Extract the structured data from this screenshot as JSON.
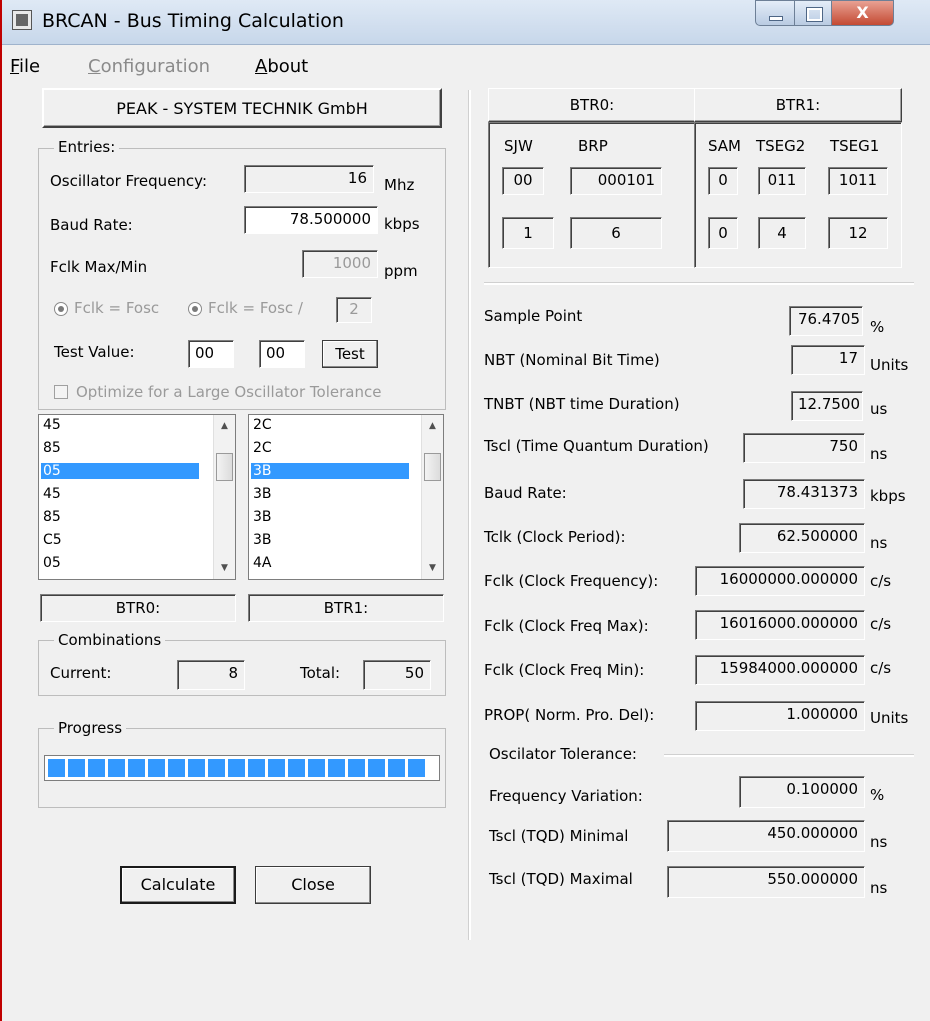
{
  "window": {
    "title": "BRCAN - Bus Timing Calculation",
    "close_glyph": "X"
  },
  "menu": {
    "file": "File",
    "configuration": "Configuration",
    "about": "About"
  },
  "company": "PEAK - SYSTEM TECHNIK GmbH",
  "entries": {
    "legend": "Entries:",
    "osc_label": "Oscillator Frequency:",
    "osc_value": "16",
    "osc_unit": "Mhz",
    "baud_label": "Baud Rate:",
    "baud_value": "78.500000",
    "baud_unit": "kbps",
    "fclk_label": "Fclk Max/Min",
    "fclk_value": "1000",
    "fclk_unit": "ppm",
    "radio1": "Fclk = Fosc",
    "radio2": "Fclk = Fosc /",
    "divider": "2",
    "test_label": "Test Value:",
    "test1": "00",
    "test2": "00",
    "test_button": "Test",
    "optimize": "Optimize for a Large Oscillator Tolerance"
  },
  "list_left": [
    "45",
    "85",
    "05",
    "45",
    "85",
    "C5",
    "05"
  ],
  "list_left_selected": 2,
  "list_right": [
    "2C",
    "2C",
    "3B",
    "3B",
    "3B",
    "3B",
    "4A"
  ],
  "list_right_selected": 2,
  "btr0_label": "BTR0:",
  "btr1_label": "BTR1:",
  "combinations": {
    "legend": "Combinations",
    "current_label": "Current:",
    "current_value": "8",
    "total_label": "Total:",
    "total_value": "50"
  },
  "progress": {
    "legend": "Progress",
    "fraction": 1.0
  },
  "buttons": {
    "calculate": "Calculate",
    "close": "Close"
  },
  "btr_table": {
    "btr0": "BTR0:",
    "btr1": "BTR1:",
    "sjw": "SJW",
    "brp": "BRP",
    "sam": "SAM",
    "tseg2": "TSEG2",
    "tseg1": "TSEG1",
    "sjw_bin": "00",
    "brp_bin": "000101",
    "sam_bin": "0",
    "tseg2_bin": "011",
    "tseg1_bin": "1011",
    "sjw_dec": "1",
    "brp_dec": "6",
    "sam_dec": "0",
    "tseg2_dec": "4",
    "tseg1_dec": "12"
  },
  "results": {
    "sample_point_label": "Sample Point",
    "sample_point": "76.4705",
    "sample_point_unit": "%",
    "nbt_label": "NBT (Nominal Bit Time)",
    "nbt": "17",
    "nbt_unit": "Units",
    "tnbt_label": "TNBT (NBT time Duration)",
    "tnbt": "12.7500",
    "tnbt_unit": "us",
    "tscl_label": "Tscl (Time Quantum Duration)",
    "tscl": "750",
    "tscl_unit": "ns",
    "baud_label": "Baud Rate:",
    "baud": "78.431373",
    "baud_unit": "kbps",
    "tclk_label": "Tclk (Clock Period):",
    "tclk": "62.500000",
    "tclk_unit": "ns",
    "fclk_label": "Fclk (Clock Frequency):",
    "fclk": "16000000.000000",
    "fclk_unit": "c/s",
    "fclkmax_label": "Fclk (Clock Freq Max):",
    "fclkmax": "16016000.000000",
    "fclkmax_unit": "c/s",
    "fclkmin_label": "Fclk (Clock Freq Min):",
    "fclkmin": "15984000.000000",
    "fclkmin_unit": "c/s",
    "prop_label": "PROP( Norm. Pro. Del):",
    "prop": "1.000000",
    "prop_unit": "Units",
    "osc_tol_label": "Oscilator Tolerance:",
    "freqvar_label": "Frequency Variation:",
    "freqvar": "0.100000",
    "freqvar_unit": "%",
    "tqdmin_label": "Tscl (TQD) Minimal",
    "tqdmin": "450.000000",
    "tqdmin_unit": "ns",
    "tqdmax_label": "Tscl (TQD) Maximal",
    "tqdmax": "550.000000",
    "tqdmax_unit": "ns"
  }
}
